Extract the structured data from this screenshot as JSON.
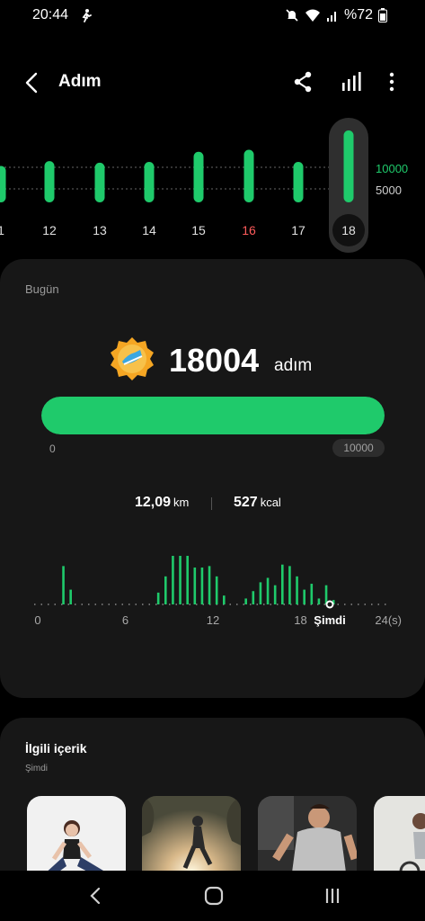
{
  "status": {
    "time": "20:44",
    "battery": "%72"
  },
  "header": {
    "title": "Adım"
  },
  "week": {
    "scale_high": "10000",
    "scale_low": "5000",
    "days": [
      {
        "label": "1",
        "value": 9000
      },
      {
        "label": "12",
        "value": 10200
      },
      {
        "label": "13",
        "value": 9800
      },
      {
        "label": "14",
        "value": 10000
      },
      {
        "label": "15",
        "value": 12500
      },
      {
        "label": "16",
        "value": 13000
      },
      {
        "label": "17",
        "value": 10000
      },
      {
        "label": "18",
        "value": 18004
      }
    ],
    "highlight_label": "16",
    "selected_label": "18"
  },
  "today": {
    "label": "Bugün",
    "steps": "18004",
    "unit": "adım",
    "progress_min": "0",
    "progress_goal": "10000",
    "progress_fraction": 1.0,
    "distance_value": "12,09",
    "distance_unit": "km",
    "calories_value": "527",
    "calories_unit": "kcal"
  },
  "chart_data": {
    "type": "bar",
    "x": [
      0,
      0.5,
      1,
      1.5,
      2,
      2.5,
      3,
      3.5,
      4,
      4.5,
      5,
      5.5,
      6,
      6.5,
      7,
      7.5,
      8,
      8.5,
      9,
      9.5,
      10,
      10.5,
      11,
      11.5,
      12,
      12.5,
      13,
      13.5,
      14,
      14.5,
      15,
      15.5,
      16,
      16.5,
      17,
      17.5,
      18,
      18.5,
      19,
      19.5
    ],
    "values": [
      0,
      0,
      52,
      20,
      0,
      0,
      0,
      0,
      0,
      0,
      0,
      0,
      0,
      0,
      0,
      16,
      38,
      78,
      66,
      82,
      50,
      50,
      52,
      38,
      12,
      0,
      0,
      8,
      18,
      30,
      36,
      26,
      54,
      52,
      38,
      20,
      28,
      8,
      26,
      6
    ],
    "xtick_labels": [
      "0",
      "6",
      "12",
      "18",
      "Şimdi",
      "24(s)"
    ],
    "xtick_positions": [
      0,
      6,
      12,
      18,
      20,
      24
    ],
    "xlim": [
      0,
      24
    ],
    "title": "",
    "xlabel": "",
    "ylabel": ""
  },
  "related": {
    "title": "İlgili içerik",
    "subtitle": "Şimdi"
  },
  "colors": {
    "accent": "#1fca6b",
    "weekend": "#ff5b5b",
    "card": "#171717"
  }
}
